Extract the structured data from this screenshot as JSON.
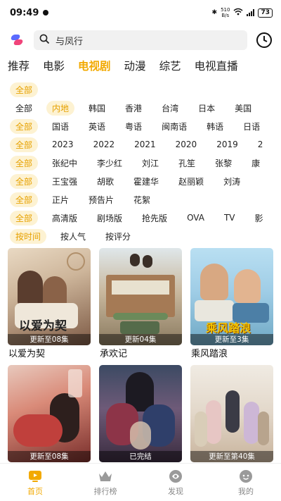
{
  "status": {
    "time": "09:49",
    "net_speed_value": "510",
    "net_speed_unit": "B/s",
    "battery": "73"
  },
  "search": {
    "text": "与凤行"
  },
  "category_tabs": [
    "推荐",
    "电影",
    "电视剧",
    "动漫",
    "综艺",
    "电视直播"
  ],
  "active_category": "电视剧",
  "filter_rows": [
    [
      "全部"
    ],
    [
      "全部",
      "内地",
      "韩国",
      "香港",
      "台湾",
      "日本",
      "美国"
    ],
    [
      "全部",
      "国语",
      "英语",
      "粤语",
      "闽南语",
      "韩语",
      "日语"
    ],
    [
      "全部",
      "2023",
      "2022",
      "2021",
      "2020",
      "2019",
      "2"
    ],
    [
      "全部",
      "张纪中",
      "李少红",
      "刘江",
      "孔笙",
      "张黎",
      "康"
    ],
    [
      "全部",
      "王宝强",
      "胡歌",
      "霍建华",
      "赵丽颖",
      "刘涛"
    ],
    [
      "全部",
      "正片",
      "预告片",
      "花絮"
    ],
    [
      "全部",
      "高清版",
      "剧场版",
      "抢先版",
      "OVA",
      "TV",
      "影"
    ],
    [
      "按时间",
      "按人气",
      "按评分"
    ]
  ],
  "selected_filters": [
    [
      0
    ],
    [
      1
    ],
    [
      0
    ],
    [
      0
    ],
    [
      0
    ],
    [
      0
    ],
    [
      0
    ],
    [
      0
    ],
    [
      0
    ]
  ],
  "shows": [
    {
      "title": "以爱为契",
      "caption": "更新至08集",
      "poster_text": "以爱为契"
    },
    {
      "title": "承欢记",
      "caption": "更新04集",
      "poster_text": ""
    },
    {
      "title": "乘风踏浪",
      "caption": "更新至3集",
      "poster_text": "乘风踏浪"
    },
    {
      "title": "",
      "caption": "更新至08集",
      "poster_text": ""
    },
    {
      "title": "",
      "caption": "已完结",
      "poster_text": ""
    },
    {
      "title": "",
      "caption": "更新至第40集",
      "poster_text": ""
    }
  ],
  "bottom_nav": [
    {
      "label": "首页",
      "icon": "home-icon"
    },
    {
      "label": "排行榜",
      "icon": "crown-icon"
    },
    {
      "label": "发现",
      "icon": "discover-icon"
    },
    {
      "label": "我的",
      "icon": "profile-icon"
    }
  ],
  "colors": {
    "accent": "#f2a900",
    "chip_bg": "#fdf2d2"
  }
}
